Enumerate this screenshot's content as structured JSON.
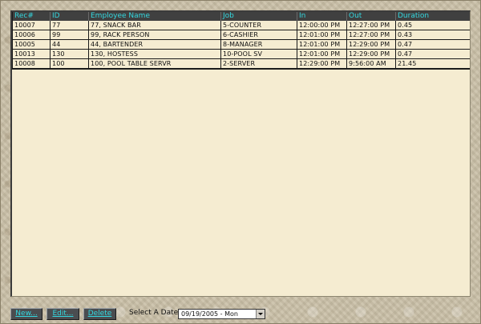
{
  "table": {
    "headers": [
      "Rec#",
      "ID",
      "Employee Name",
      "Job",
      "In",
      "Out",
      "Duration"
    ],
    "rows": [
      [
        "10007",
        "77",
        "77, SNACK BAR",
        "5-COUNTER",
        "12:00:00 PM",
        "12:27:00 PM",
        "0.45"
      ],
      [
        "10006",
        "99",
        "99, RACK PERSON",
        "6-CASHIER",
        "12:01:00 PM",
        "12:27:00 PM",
        "0.43"
      ],
      [
        "10005",
        "44",
        "44, BARTENDER",
        "8-MANAGER",
        "12:01:00 PM",
        "12:29:00 PM",
        "0.47"
      ],
      [
        "10013",
        "130",
        "130, HOSTESS",
        "10-POOL SV",
        "12:01:00 PM",
        "12:29:00 PM",
        "0.47"
      ],
      [
        "10008",
        "100",
        "100, POOL TABLE SERVR",
        "2-SERVER",
        "12:29:00 PM",
        "9:56:00 AM",
        "21.45"
      ]
    ]
  },
  "toolbar": {
    "new_label": "New...",
    "edit_label": "Edit...",
    "delete_label": "Delete"
  },
  "date_picker": {
    "label": "Select A Date:",
    "value": "09/19/2005 - Mon"
  },
  "colors": {
    "header_bg": "#404040",
    "header_text": "#33d8e0",
    "grid_bg": "#f5ecd1"
  }
}
